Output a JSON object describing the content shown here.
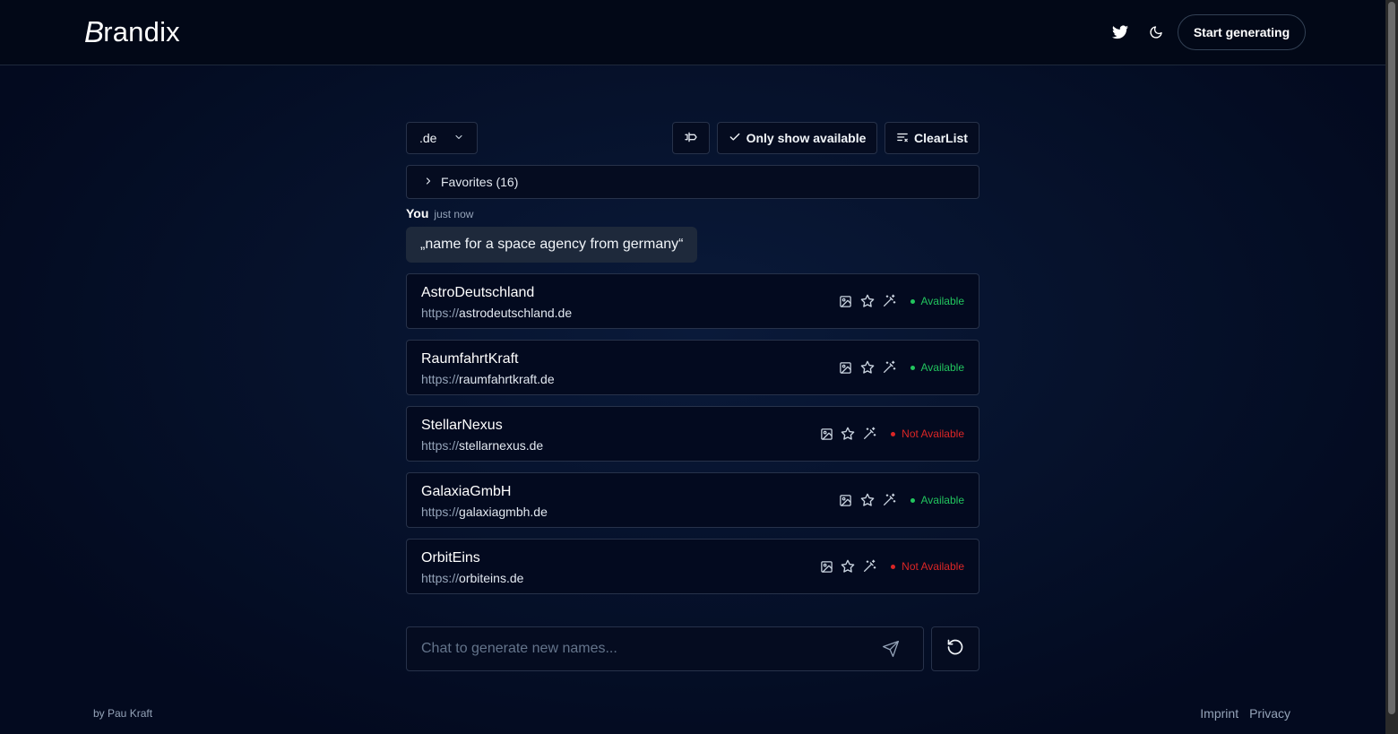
{
  "brand": {
    "logo_first": "B",
    "logo_rest": "randix"
  },
  "header": {
    "twitter_icon": "twitter-icon",
    "theme_icon": "moon-icon",
    "start_label": "Start generating"
  },
  "toolbar": {
    "tld_value": ".de",
    "only_available_label": "Only show available",
    "clear_label": "ClearList"
  },
  "favorites": {
    "label": "Favorites (16)"
  },
  "message": {
    "author": "You",
    "time": "just now",
    "text": "„name for a space agency from germany“"
  },
  "results": [
    {
      "name": "AstroDeutschland",
      "proto": "https://",
      "domain": "astrodeutschland.de",
      "status": "Available"
    },
    {
      "name": "RaumfahrtKraft",
      "proto": "https://",
      "domain": "raumfahrtkraft.de",
      "status": "Available"
    },
    {
      "name": "StellarNexus",
      "proto": "https://",
      "domain": "stellarnexus.de",
      "status": "Not Available"
    },
    {
      "name": "GalaxiaGmbH",
      "proto": "https://",
      "domain": "galaxiagmbh.de",
      "status": "Available"
    },
    {
      "name": "OrbitEins",
      "proto": "https://",
      "domain": "orbiteins.de",
      "status": "Not Available"
    }
  ],
  "chat": {
    "placeholder": "Chat to generate new names..."
  },
  "footer": {
    "credit": "by Pau Kraft",
    "imprint": "Imprint",
    "privacy": "Privacy"
  },
  "colors": {
    "available": "#22c55e",
    "not_available": "#dc2626",
    "background": "#030a1f",
    "border": "#27324a"
  }
}
